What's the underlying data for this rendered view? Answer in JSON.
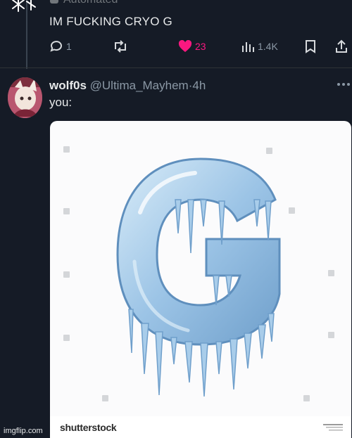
{
  "top_tweet": {
    "account_label": "Automated",
    "text": "IM FUCKING CRYO G",
    "actions": {
      "reply_count": "1",
      "like_count": "23",
      "views_count": "1.4K"
    }
  },
  "reply_tweet": {
    "display_name": "wolf0s",
    "handle": "@Ultima_Mayhem",
    "separator": "·",
    "time": "4h",
    "text": "you:",
    "media": {
      "watermark_logo": "shutterstock",
      "subject": "ice-letter-g"
    }
  },
  "footer": {
    "imgflip": "imgflip.com"
  },
  "colors": {
    "background": "#151b26",
    "like_pink": "#f91880",
    "muted": "#8b98a5",
    "ice": "#9cc4e6"
  }
}
